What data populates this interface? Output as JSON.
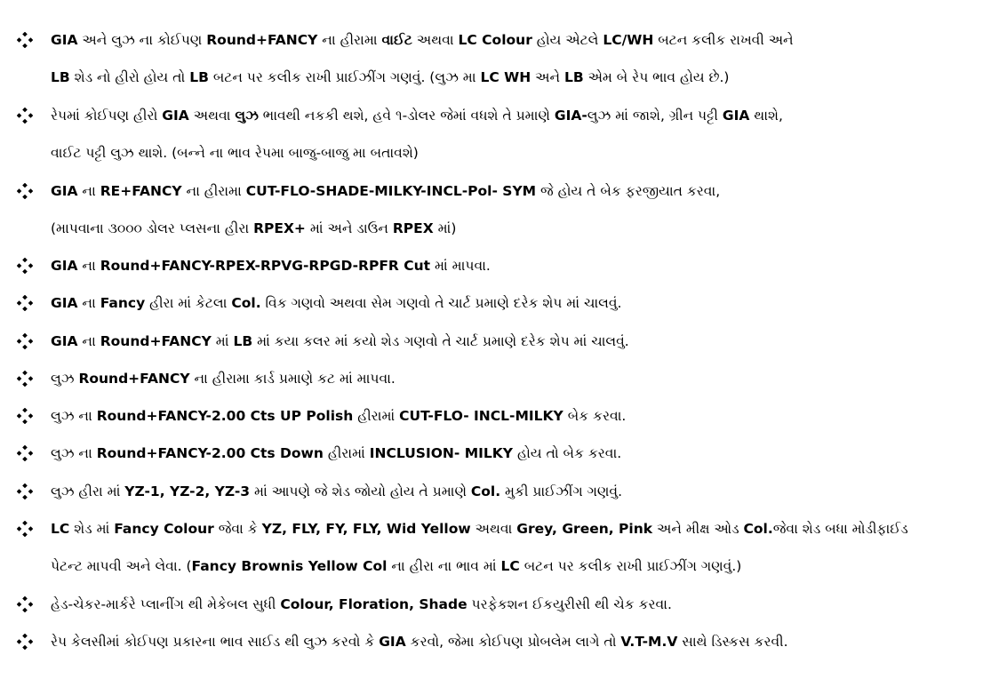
{
  "items": [
    {
      "lines": [
        [
          {
            "t": "GIA",
            "b": true
          },
          {
            "t": " અને લુઝ ના કોઈપણ "
          },
          {
            "t": "Round+FANCY",
            "b": true
          },
          {
            "t": " ના હીરામા "
          },
          {
            "t": "વાઈટ",
            "b": true
          },
          {
            "t": " અથવા "
          },
          {
            "t": "LC Colour",
            "b": true
          },
          {
            "t": " હોય એટલે "
          },
          {
            "t": "LC/WH",
            "b": true
          },
          {
            "t": " બટન કલીક રાખવી અને"
          }
        ],
        [
          {
            "t": "LB",
            "b": true
          },
          {
            "t": " શેડ નો હીરો હોય તો "
          },
          {
            "t": "LB",
            "b": true
          },
          {
            "t": " બટન પર કલીક રાખી પ્રાઈઝીંગ ગણવું. (લુઝ મા "
          },
          {
            "t": "LC WH",
            "b": true
          },
          {
            "t": " અને "
          },
          {
            "t": "LB",
            "b": true
          },
          {
            "t": " એમ બે રેપ ભાવ હોય છે.)"
          }
        ]
      ]
    },
    {
      "lines": [
        [
          {
            "t": "રેપમાં કોઈપણ હીરો "
          },
          {
            "t": "GIA",
            "b": true
          },
          {
            "t": " અથવા "
          },
          {
            "t": "લુઝ",
            "b": true
          },
          {
            "t": " ભાવથી નકકી થશે, હવે ૧-ડોલર જેમાં વધશે તે પ્રમાણે "
          },
          {
            "t": "GIA-",
            "b": true
          },
          {
            "t": "લુઝ માં જાશે, ગ્રીન પટ્ટી "
          },
          {
            "t": "GIA",
            "b": true
          },
          {
            "t": " થાશે,"
          }
        ],
        [
          {
            "t": "વાઈટ પટ્ટી લુઝ થાશે. (બન્ને ના ભાવ રેપમા બાજુ-બાજુ મા બતાવશે)"
          }
        ]
      ]
    },
    {
      "lines": [
        [
          {
            "t": "GIA",
            "b": true
          },
          {
            "t": " ના "
          },
          {
            "t": "RE+FANCY",
            "b": true
          },
          {
            "t": " ના હીરામા "
          },
          {
            "t": "CUT-FLO-SHADE-MILKY-INCL-Pol- SYM",
            "b": true
          },
          {
            "t": " જે હોય તે બેક ફરજીયાત કરવા,"
          }
        ],
        [
          {
            "t": "(માપવાના ૩૦૦૦ ડોલર પ્લસના હીરા "
          },
          {
            "t": "RPEX+",
            "b": true
          },
          {
            "t": " માં અને ડાઉન "
          },
          {
            "t": "RPEX",
            "b": true
          },
          {
            "t": " માં)"
          }
        ]
      ]
    },
    {
      "lines": [
        [
          {
            "t": "GIA",
            "b": true
          },
          {
            "t": " ના "
          },
          {
            "t": "Round+FANCY-RPEX-RPVG-RPGD-RPFR Cut",
            "b": true
          },
          {
            "t": " માં માપવા."
          }
        ]
      ]
    },
    {
      "lines": [
        [
          {
            "t": "GIA",
            "b": true
          },
          {
            "t": " ના "
          },
          {
            "t": "Fancy",
            "b": true
          },
          {
            "t": " હીરા માં કેટલા "
          },
          {
            "t": "Col.",
            "b": true
          },
          {
            "t": " વિક ગણવો અથવા સેમ ગણવો તે ચાર્ટ પ્રમાણે દરેક શેપ માં ચાલવું."
          }
        ]
      ]
    },
    {
      "lines": [
        [
          {
            "t": "GIA",
            "b": true
          },
          {
            "t": " ના "
          },
          {
            "t": "Round+FANCY",
            "b": true
          },
          {
            "t": " માં "
          },
          {
            "t": "LB",
            "b": true
          },
          {
            "t": " માં કયા કલર માં કયો શેડ ગણવો તે ચાર્ટ પ્રમાણે દરેક શેપ માં ચાલવું."
          }
        ]
      ]
    },
    {
      "lines": [
        [
          {
            "t": "લુઝ "
          },
          {
            "t": "Round+FANCY",
            "b": true
          },
          {
            "t": " ના હીરામા કાર્ડ પ્રમાણે કટ માં માપવા."
          }
        ]
      ]
    },
    {
      "lines": [
        [
          {
            "t": "લુઝ ના "
          },
          {
            "t": "Round+FANCY-2.00 Cts UP Polish",
            "b": true
          },
          {
            "t": " હીરામાં "
          },
          {
            "t": "CUT-FLO- INCL-MILKY",
            "b": true
          },
          {
            "t": " બેક કરવા."
          }
        ]
      ]
    },
    {
      "lines": [
        [
          {
            "t": "લુઝ ના "
          },
          {
            "t": "Round+FANCY-2.00 Cts Down",
            "b": true
          },
          {
            "t": " હીરામાં "
          },
          {
            "t": "INCLUSION- MILKY",
            "b": true
          },
          {
            "t": " હોય તો બેક કરવા."
          }
        ]
      ]
    },
    {
      "lines": [
        [
          {
            "t": "લુઝ હીરા માં "
          },
          {
            "t": "YZ-1, YZ-2, YZ-3",
            "b": true
          },
          {
            "t": " માં આપણે જે શેડ જોયો હોય તે પ્રમાણે "
          },
          {
            "t": "Col.",
            "b": true
          },
          {
            "t": " મુકી પ્રાઈઝીંગ ગણવું."
          }
        ]
      ]
    },
    {
      "lines": [
        [
          {
            "t": "LC",
            "b": true
          },
          {
            "t": " શેડ માં "
          },
          {
            "t": "Fancy Colour",
            "b": true
          },
          {
            "t": " જેવા કે "
          },
          {
            "t": "YZ, FLY, FY, FLY, Wid Yellow",
            "b": true
          },
          {
            "t": " અથવા "
          },
          {
            "t": "Grey, Green, Pink",
            "b": true
          },
          {
            "t": " અને મીક્ષ ઓડ "
          },
          {
            "t": "Col.",
            "b": true
          },
          {
            "t": "જેવા શેડ બધા મોડીફાઈડ"
          }
        ],
        [
          {
            "t": "પેટન્ટ માપવી અને લેવા. ("
          },
          {
            "t": "Fancy Brownis Yellow Col",
            "b": true
          },
          {
            "t": " ના હીરા ના ભાવ માં "
          },
          {
            "t": "LC",
            "b": true
          },
          {
            "t": " બટન પર કલીક રાખી પ્રાઈઝીંગ ગણવું.)"
          }
        ]
      ]
    },
    {
      "lines": [
        [
          {
            "t": "હેડ-ચેકર-માર્કરે પ્લાનીંગ થી મેકેબલ સુધી "
          },
          {
            "t": "Colour, Floration, Shade",
            "b": true
          },
          {
            "t": " પરફેકશન ઈકયુરીસી થી ચેક કરવા."
          }
        ]
      ]
    },
    {
      "lines": [
        [
          {
            "t": "રેપ કેલસીમાં કોઈપણ પ્રકારના ભાવ સાઈડ થી લુઝ કરવો કે "
          },
          {
            "t": "GIA",
            "b": true
          },
          {
            "t": " કરવો, જેમા કોઈપણ પ્રોબલેમ લાગે તો "
          },
          {
            "t": "V.T-M.V",
            "b": true
          },
          {
            "t": " સાથે ડિસ્કસ કરવી."
          }
        ]
      ]
    }
  ]
}
